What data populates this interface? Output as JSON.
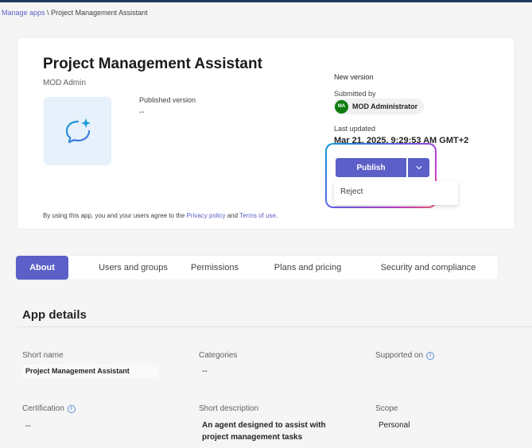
{
  "breadcrumb": {
    "parent": "Manage apps",
    "separator": " \\ ",
    "current": "Project Management Assistant"
  },
  "app": {
    "title": "Project Management Assistant",
    "publisher": "MOD Admin",
    "published_version_label": "Published version",
    "published_version_value": "--",
    "icon": "copilot-agent-icon"
  },
  "new_version": {
    "label": "New version",
    "submitted_by_label": "Submitted by",
    "submitter_initials": "MA",
    "submitter_name": "MOD Administrator",
    "last_updated_label": "Last updated",
    "last_updated_value": "Mar 21, 2025, 9:29:53 AM GMT+2"
  },
  "actions": {
    "publish_label": "Publish",
    "reject_label": "Reject"
  },
  "terms": {
    "prefix": "By using this app, you and your users agree to the ",
    "privacy": "Privacy policy",
    "and": " and ",
    "terms_of_use": "Terms of use",
    "suffix": "."
  },
  "tabs": [
    {
      "label": "About",
      "active": true
    },
    {
      "label": "Users and groups",
      "active": false
    },
    {
      "label": "Permissions",
      "active": false
    },
    {
      "label": "Plans and pricing",
      "active": false
    },
    {
      "label": "Security and compliance",
      "active": false
    }
  ],
  "details": {
    "title": "App details",
    "short_name_label": "Short name",
    "short_name_value": "Project Management Assistant",
    "categories_label": "Categories",
    "categories_value": "--",
    "supported_on_label": "Supported on",
    "certification_label": "Certification",
    "certification_value": "--",
    "short_description_label": "Short description",
    "short_description_value": "An agent designed to assist with project management tasks",
    "scope_label": "Scope",
    "scope_value": "Personal"
  },
  "colors": {
    "accent": "#5b5fc7",
    "avatar": "#107c10",
    "highlight_gradient": [
      "#0f9bd7",
      "#6b5de6",
      "#c03bd3",
      "#f25c7b"
    ]
  }
}
